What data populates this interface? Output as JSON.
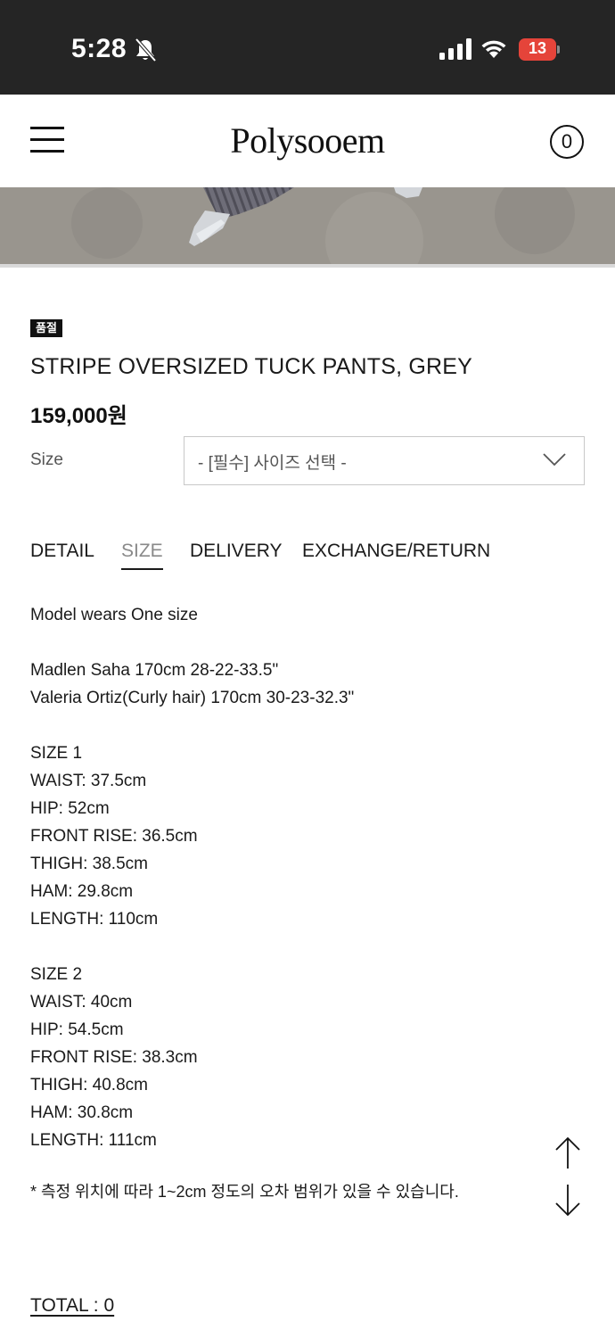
{
  "status_bar": {
    "time": "5:28",
    "battery": "13",
    "icons": [
      "bell-slash-icon",
      "signal-icon",
      "wifi-icon",
      "battery-icon"
    ],
    "battery_color": "#e5443a"
  },
  "header": {
    "logo": "Polysooem",
    "cart_count": "0",
    "menu_icon": "hamburger-menu-icon"
  },
  "product": {
    "badge": "품절",
    "name": "STRIPE OVERSIZED TUCK PANTS, GREY",
    "price": "159,000원",
    "size_label": "Size",
    "size_select_value": "- [필수] 사이즈 선택 -"
  },
  "tabs": [
    {
      "label": "DETAIL",
      "active": false
    },
    {
      "label": "SIZE",
      "active": true
    },
    {
      "label": "DELIVERY",
      "active": false
    },
    {
      "label": "EXCHANGE/RETURN",
      "active": false
    }
  ],
  "description": {
    "model_wears": "Model wears One size",
    "model_1": "Madlen Saha 170cm 28-22-33.5\"",
    "model_2": "Valeria Ortiz(Curly hair) 170cm 30-23-32.3\"",
    "size1": {
      "title": "SIZE 1",
      "waist": "WAIST: 37.5cm",
      "hip": "HIP: 52cm",
      "front_rise": "FRONT RISE: 36.5cm",
      "thigh": "THIGH: 38.5cm",
      "ham": "HAM: 29.8cm",
      "length": "LENGTH: 110cm"
    },
    "size2": {
      "title": "SIZE 2",
      "waist": "WAIST: 40cm",
      "hip": "HIP: 54.5cm",
      "front_rise": "FRONT RISE: 38.3cm",
      "thigh": "THIGH: 40.8cm",
      "ham": "HAM: 30.8cm",
      "length": "LENGTH: 111cm"
    },
    "note": "* 측정 위치에 따라 1~2cm 정도의 오차 범위가 있을 수 있습니다."
  },
  "total": "TOTAL : 0",
  "colors": {
    "status_bar_bg": "#252525",
    "text": "#1a1a1a",
    "active_tab": "#8a8a8a"
  }
}
